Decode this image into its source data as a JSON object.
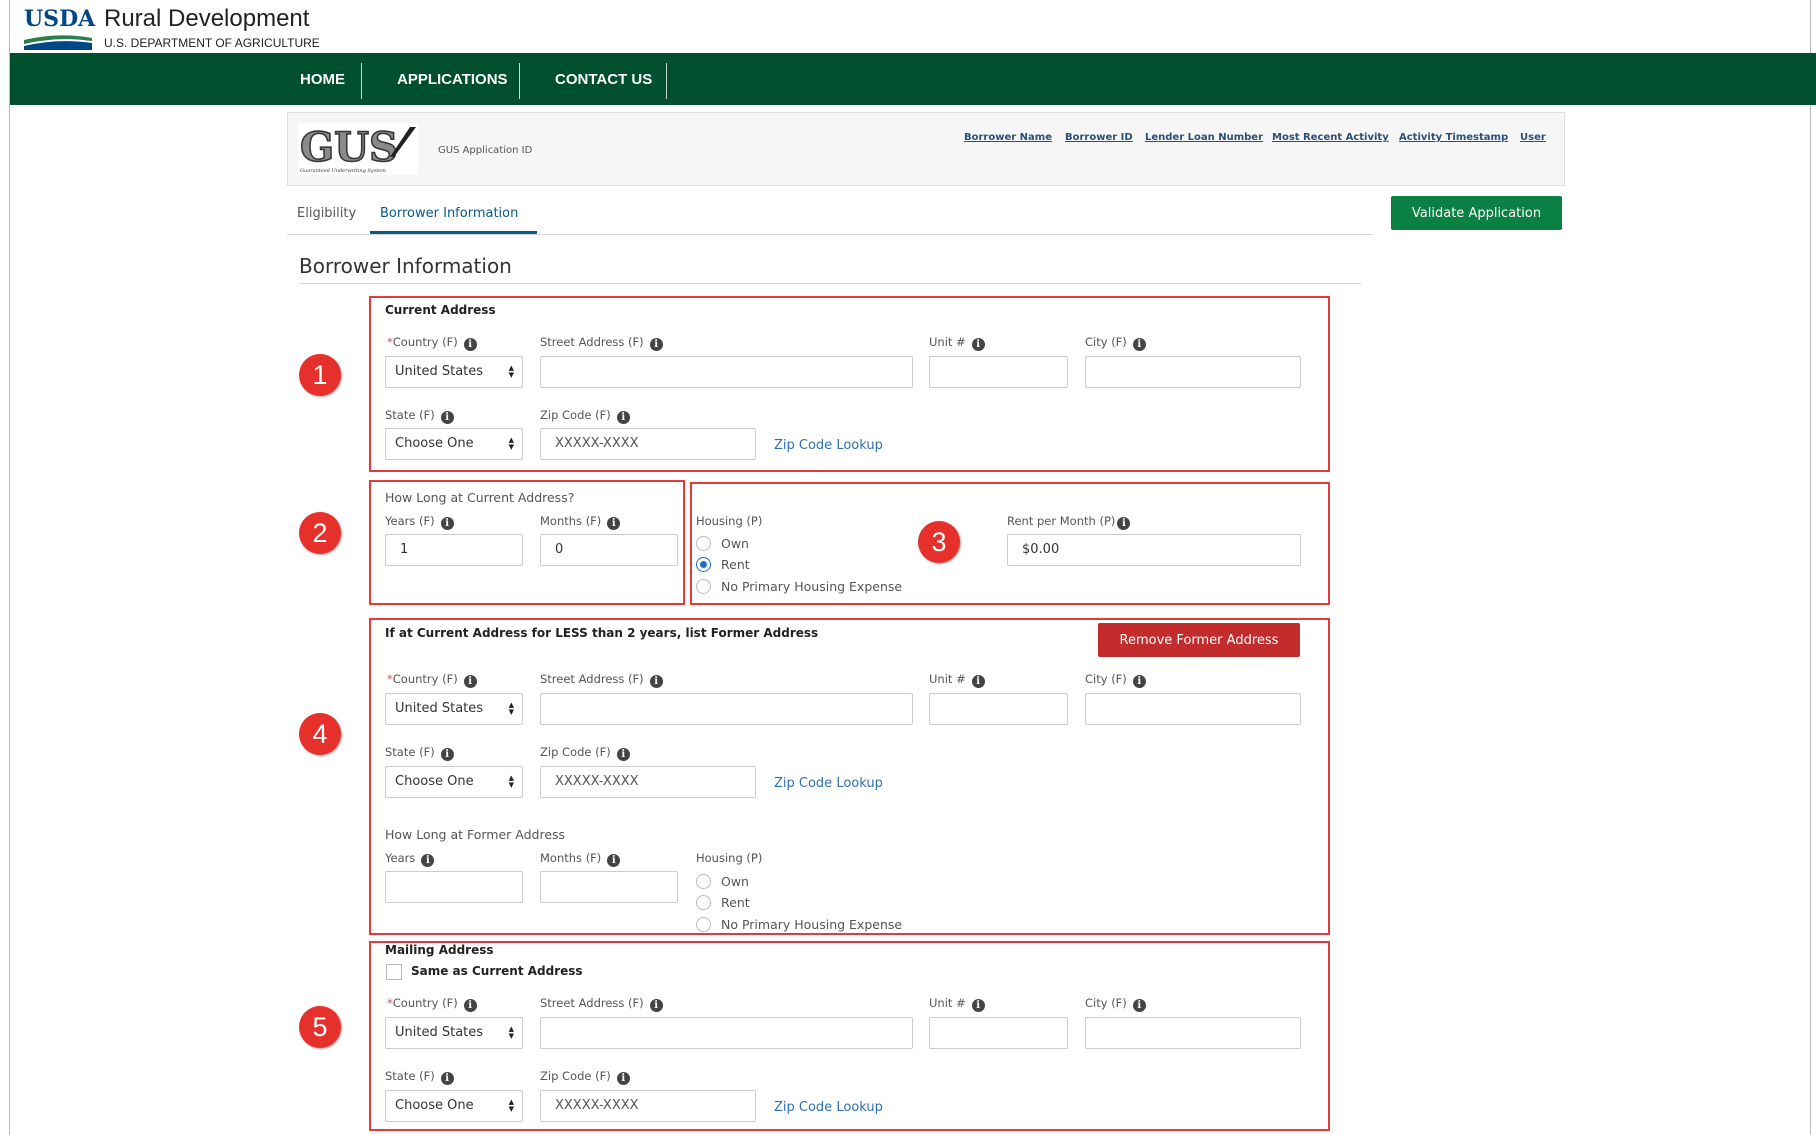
{
  "header": {
    "usda_word": "USDA",
    "agency_title": "Rural Development",
    "agency_subtitle": "U.S. DEPARTMENT OF AGRICULTURE"
  },
  "nav": {
    "items": [
      "HOME",
      "APPLICATIONS",
      "CONTACT US"
    ]
  },
  "gus_panel": {
    "logo_text": "GUS",
    "logo_caption": "Guaranteed Underwriting System",
    "app_id_label": "GUS Application ID",
    "links": [
      "Borrower Name",
      "Borrower ID",
      "Lender Loan Number",
      "Most Recent Activity",
      "Activity Timestamp",
      "User"
    ]
  },
  "tabs": {
    "eligibility": "Eligibility",
    "borrower": "Borrower Information"
  },
  "validate_label": "Validate Application",
  "page_title": "Borrower Information",
  "badges": [
    "1",
    "2",
    "3",
    "4",
    "5"
  ],
  "labels": {
    "country_star": "*",
    "country": "Country (F)",
    "street": "Street Address (F)",
    "unit": "Unit #",
    "city": "City (F)",
    "state": "State (F)",
    "zip": "Zip Code (F)",
    "years_f": "Years (F)",
    "years": "Years",
    "months": "Months (F)",
    "housing": "Housing (P)",
    "rent_per_month": "Rent per Month (P)",
    "zip_lookup": "Zip Code Lookup",
    "zip_placeholder": "XXXXX-XXXX"
  },
  "current_address": {
    "heading": "Current Address",
    "country_value": "United States",
    "state_value": "Choose One"
  },
  "how_long_current": {
    "heading": "How Long at Current Address?",
    "years_value": "1",
    "months_value": "0"
  },
  "housing_current": {
    "options": [
      "Own",
      "Rent",
      "No Primary Housing Expense"
    ],
    "selected": "Rent",
    "rent_value": "$0.00"
  },
  "former_address": {
    "heading": "If at Current Address for LESS than 2 years, list Former Address",
    "remove_label": "Remove Former Address",
    "country_value": "United States",
    "state_value": "Choose One",
    "how_long_heading": "How Long at Former Address",
    "housing_options": [
      "Own",
      "Rent",
      "No Primary Housing Expense"
    ]
  },
  "mailing_address": {
    "heading": "Mailing Address",
    "same_as_label": "Same as Current Address",
    "country_value": "United States",
    "state_value": "Choose One"
  },
  "colors": {
    "nav_green": "#005030",
    "validate_green": "#0a8043",
    "remove_red": "#c22c2c",
    "annotation_red": "#e33b3b"
  }
}
